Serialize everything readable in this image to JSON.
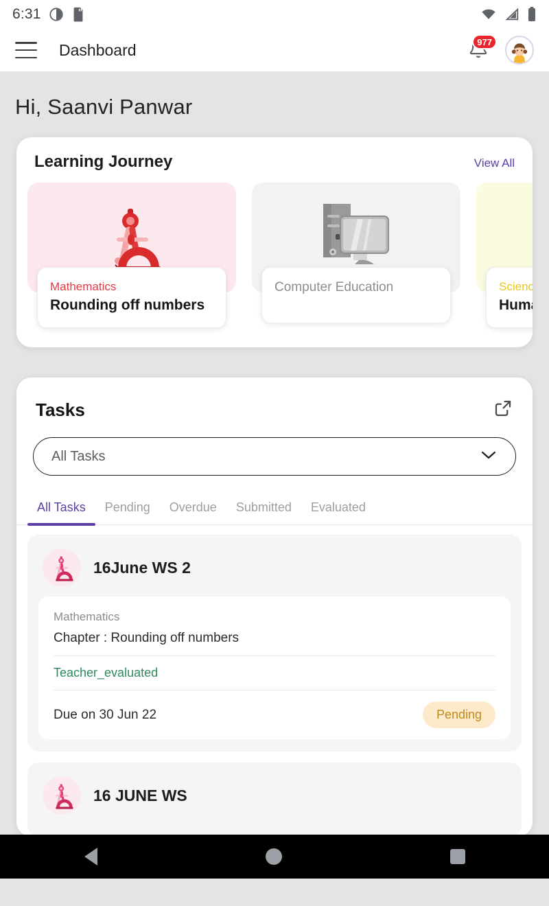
{
  "status_bar": {
    "time": "6:31",
    "left_icons": [
      "do-not-disturb-icon",
      "sd-card-icon"
    ],
    "right_icons": [
      "wifi-icon",
      "cellular-signal-icon",
      "battery-icon"
    ]
  },
  "app_bar": {
    "menu_icon": "hamburger-menu-icon",
    "title": "Dashboard",
    "notification_icon": "bell-icon",
    "notification_count": "977",
    "avatar_icon": "user-avatar"
  },
  "greeting": "Hi, Saanvi Panwar",
  "learning_journey": {
    "title": "Learning Journey",
    "view_all_label": "View All",
    "cards": [
      {
        "subject": "Mathematics",
        "chapter": "Rounding off numbers",
        "icon": "compass-protractor-icon",
        "hero_bg": "#fce9ee",
        "subject_color": "#e03a45"
      },
      {
        "subject": "Computer Education",
        "chapter": "",
        "icon": "desktop-computer-icon",
        "hero_bg": "#f2f2f2",
        "subject_color": "#8d8d8d"
      },
      {
        "subject": "Science",
        "chapter": "Human",
        "icon": "science-icon",
        "hero_bg": "#fbfbe0",
        "subject_color": "#e8c61d"
      }
    ]
  },
  "tasks": {
    "title": "Tasks",
    "external_link_icon": "open-in-new-icon",
    "filter": {
      "selected": "All Tasks",
      "placeholder": "All Tasks",
      "caret_icon": "chevron-down-icon"
    },
    "tabs": [
      {
        "label": "All Tasks",
        "active": true
      },
      {
        "label": "Pending",
        "active": false
      },
      {
        "label": "Overdue",
        "active": false
      },
      {
        "label": "Submitted",
        "active": false
      },
      {
        "label": "Evaluated",
        "active": false
      }
    ],
    "items": [
      {
        "title": "16June WS 2",
        "icon": "compass-protractor-icon",
        "subject": "Mathematics",
        "chapter": "Chapter : Rounding off numbers",
        "status": "Teacher_evaluated",
        "due": "Due on 30 Jun 22",
        "badge": "Pending"
      },
      {
        "title": "16 JUNE WS",
        "icon": "compass-protractor-icon",
        "subject": "",
        "chapter": "",
        "status": "",
        "due": "",
        "badge": ""
      }
    ]
  },
  "nav_bar": {
    "back_icon": "back-triangle-icon",
    "home_icon": "home-circle-icon",
    "recents_icon": "recents-square-icon"
  },
  "colors": {
    "accent_purple": "#5b3fa6",
    "badge_red": "#e8252a",
    "status_green": "#2f8a5b",
    "pill_text": "#c08a1e",
    "pill_bg": "#fdeacb",
    "page_bg": "#e4e4e4"
  }
}
